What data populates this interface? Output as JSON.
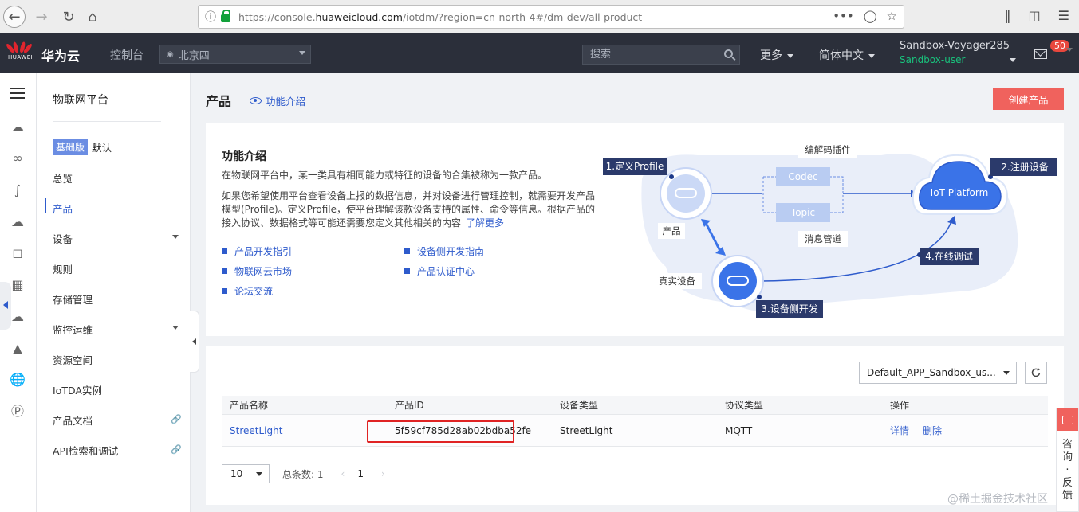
{
  "browser": {
    "url_prefix": "https://console.",
    "url_domain": "huaweicloud.com",
    "url_suffix": "/iotdm/?region=cn-north-4#/dm-dev/all-product",
    "more": "•••"
  },
  "header": {
    "logo_word": "HUAWEI",
    "brand": "华为云",
    "console": "控制台",
    "region": "北京四",
    "search_placeholder": "搜索",
    "more": "更多",
    "language": "简体中文",
    "user_name": "Sandbox-Voyager285",
    "user_sub": "Sandbox-user",
    "mail_count": "50"
  },
  "sidebar": {
    "title": "物联网平台",
    "edition_badge": "基础版",
    "edition_default": "默认",
    "items": [
      {
        "label": "总览"
      },
      {
        "label": "产品"
      },
      {
        "label": "设备"
      },
      {
        "label": "规则"
      },
      {
        "label": "存储管理"
      },
      {
        "label": "监控运维"
      },
      {
        "label": "资源空间"
      },
      {
        "label": "IoTDA实例"
      },
      {
        "label": "产品文档"
      },
      {
        "label": "API检索和调试"
      }
    ]
  },
  "main": {
    "title": "产品",
    "intro_link": "功能介绍",
    "create_button": "创建产品",
    "intro": {
      "title": "功能介绍",
      "p1": "在物联网平台中，某一类具有相同能力或特征的设备的合集被称为一款产品。",
      "p2": "如果您希望使用平台查看设备上报的数据信息，并对设备进行管理控制，就需要开发产品模型(Profile)。定义Profile，使平台理解该款设备支持的属性、命令等信息。根据产品的接入协议、数据格式等可能还需要您定义其他相关的内容",
      "learn_more": "了解更多",
      "links": [
        "产品开发指引",
        "设备侧开发指南",
        "物联网云市场",
        "产品认证中心",
        "论坛交流"
      ]
    },
    "diagram": {
      "step1": "1.定义Profile",
      "step2": "2.注册设备",
      "step3": "3.设备侧开发",
      "step4": "4.在线调试",
      "codec_plugin": "编解码插件",
      "codec": "Codec",
      "topic": "Topic",
      "message_pipe": "消息管道",
      "product": "产品",
      "real_device": "真实设备",
      "platform": "IoT Platform"
    },
    "table": {
      "app_select": "Default_APP_Sandbox_us...",
      "headers": [
        "产品名称",
        "产品ID",
        "设备类型",
        "协议类型",
        "操作"
      ],
      "rows": [
        {
          "name": "StreetLight",
          "id": "5f59cf785d28ab02bdba52fe",
          "device_type": "StreetLight",
          "protocol": "MQTT",
          "detail": "详情",
          "delete": "删除"
        }
      ],
      "page_size": "10",
      "total_label": "总条数: 1",
      "prev": "‹",
      "page": "1",
      "next": "›"
    }
  },
  "feedback": {
    "label": "咨询·反馈"
  },
  "watermark": "@稀土掘金技术社区"
}
